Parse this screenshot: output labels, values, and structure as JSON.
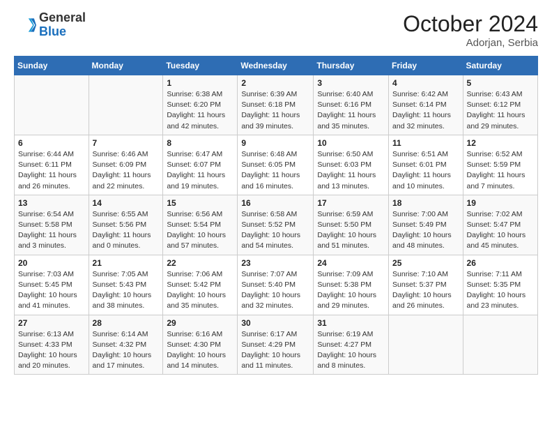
{
  "header": {
    "logo_general": "General",
    "logo_blue": "Blue",
    "month_title": "October 2024",
    "subtitle": "Adorjan, Serbia"
  },
  "weekdays": [
    "Sunday",
    "Monday",
    "Tuesday",
    "Wednesday",
    "Thursday",
    "Friday",
    "Saturday"
  ],
  "weeks": [
    [
      {
        "day": "",
        "info": ""
      },
      {
        "day": "",
        "info": ""
      },
      {
        "day": "1",
        "info": "Sunrise: 6:38 AM\nSunset: 6:20 PM\nDaylight: 11 hours and 42 minutes."
      },
      {
        "day": "2",
        "info": "Sunrise: 6:39 AM\nSunset: 6:18 PM\nDaylight: 11 hours and 39 minutes."
      },
      {
        "day": "3",
        "info": "Sunrise: 6:40 AM\nSunset: 6:16 PM\nDaylight: 11 hours and 35 minutes."
      },
      {
        "day": "4",
        "info": "Sunrise: 6:42 AM\nSunset: 6:14 PM\nDaylight: 11 hours and 32 minutes."
      },
      {
        "day": "5",
        "info": "Sunrise: 6:43 AM\nSunset: 6:12 PM\nDaylight: 11 hours and 29 minutes."
      }
    ],
    [
      {
        "day": "6",
        "info": "Sunrise: 6:44 AM\nSunset: 6:11 PM\nDaylight: 11 hours and 26 minutes."
      },
      {
        "day": "7",
        "info": "Sunrise: 6:46 AM\nSunset: 6:09 PM\nDaylight: 11 hours and 22 minutes."
      },
      {
        "day": "8",
        "info": "Sunrise: 6:47 AM\nSunset: 6:07 PM\nDaylight: 11 hours and 19 minutes."
      },
      {
        "day": "9",
        "info": "Sunrise: 6:48 AM\nSunset: 6:05 PM\nDaylight: 11 hours and 16 minutes."
      },
      {
        "day": "10",
        "info": "Sunrise: 6:50 AM\nSunset: 6:03 PM\nDaylight: 11 hours and 13 minutes."
      },
      {
        "day": "11",
        "info": "Sunrise: 6:51 AM\nSunset: 6:01 PM\nDaylight: 11 hours and 10 minutes."
      },
      {
        "day": "12",
        "info": "Sunrise: 6:52 AM\nSunset: 5:59 PM\nDaylight: 11 hours and 7 minutes."
      }
    ],
    [
      {
        "day": "13",
        "info": "Sunrise: 6:54 AM\nSunset: 5:58 PM\nDaylight: 11 hours and 3 minutes."
      },
      {
        "day": "14",
        "info": "Sunrise: 6:55 AM\nSunset: 5:56 PM\nDaylight: 11 hours and 0 minutes."
      },
      {
        "day": "15",
        "info": "Sunrise: 6:56 AM\nSunset: 5:54 PM\nDaylight: 10 hours and 57 minutes."
      },
      {
        "day": "16",
        "info": "Sunrise: 6:58 AM\nSunset: 5:52 PM\nDaylight: 10 hours and 54 minutes."
      },
      {
        "day": "17",
        "info": "Sunrise: 6:59 AM\nSunset: 5:50 PM\nDaylight: 10 hours and 51 minutes."
      },
      {
        "day": "18",
        "info": "Sunrise: 7:00 AM\nSunset: 5:49 PM\nDaylight: 10 hours and 48 minutes."
      },
      {
        "day": "19",
        "info": "Sunrise: 7:02 AM\nSunset: 5:47 PM\nDaylight: 10 hours and 45 minutes."
      }
    ],
    [
      {
        "day": "20",
        "info": "Sunrise: 7:03 AM\nSunset: 5:45 PM\nDaylight: 10 hours and 41 minutes."
      },
      {
        "day": "21",
        "info": "Sunrise: 7:05 AM\nSunset: 5:43 PM\nDaylight: 10 hours and 38 minutes."
      },
      {
        "day": "22",
        "info": "Sunrise: 7:06 AM\nSunset: 5:42 PM\nDaylight: 10 hours and 35 minutes."
      },
      {
        "day": "23",
        "info": "Sunrise: 7:07 AM\nSunset: 5:40 PM\nDaylight: 10 hours and 32 minutes."
      },
      {
        "day": "24",
        "info": "Sunrise: 7:09 AM\nSunset: 5:38 PM\nDaylight: 10 hours and 29 minutes."
      },
      {
        "day": "25",
        "info": "Sunrise: 7:10 AM\nSunset: 5:37 PM\nDaylight: 10 hours and 26 minutes."
      },
      {
        "day": "26",
        "info": "Sunrise: 7:11 AM\nSunset: 5:35 PM\nDaylight: 10 hours and 23 minutes."
      }
    ],
    [
      {
        "day": "27",
        "info": "Sunrise: 6:13 AM\nSunset: 4:33 PM\nDaylight: 10 hours and 20 minutes."
      },
      {
        "day": "28",
        "info": "Sunrise: 6:14 AM\nSunset: 4:32 PM\nDaylight: 10 hours and 17 minutes."
      },
      {
        "day": "29",
        "info": "Sunrise: 6:16 AM\nSunset: 4:30 PM\nDaylight: 10 hours and 14 minutes."
      },
      {
        "day": "30",
        "info": "Sunrise: 6:17 AM\nSunset: 4:29 PM\nDaylight: 10 hours and 11 minutes."
      },
      {
        "day": "31",
        "info": "Sunrise: 6:19 AM\nSunset: 4:27 PM\nDaylight: 10 hours and 8 minutes."
      },
      {
        "day": "",
        "info": ""
      },
      {
        "day": "",
        "info": ""
      }
    ]
  ]
}
